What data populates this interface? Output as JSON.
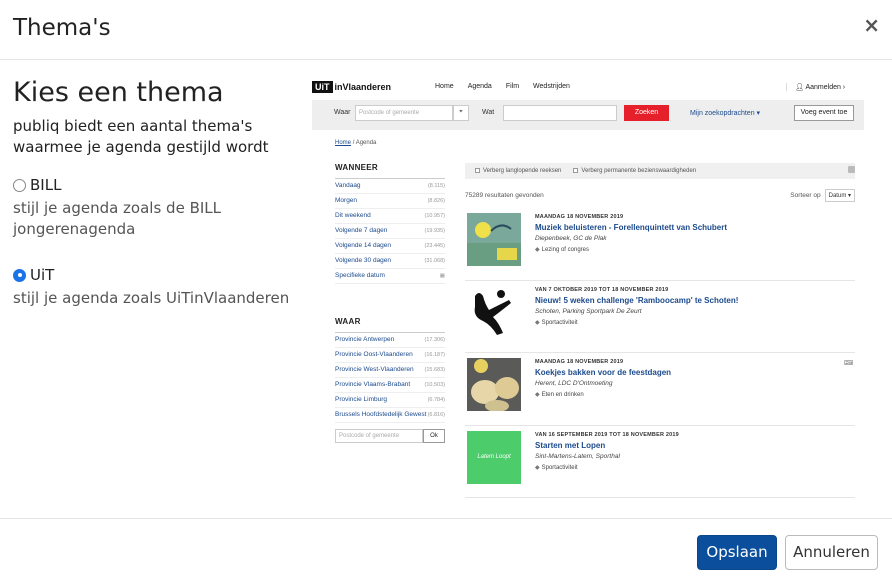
{
  "dialog": {
    "title": "Thema's",
    "close_label": "×"
  },
  "left": {
    "heading": "Kies een thema",
    "intro": "publiq biedt een aantal thema's waarmee je agenda gestijld wordt",
    "options": [
      {
        "label": "BILL",
        "description": "stijl je agenda zoals de BILL jongerenagenda",
        "selected": false
      },
      {
        "label": "UiT",
        "description": "stijl je agenda zoals UiTinVlaanderen",
        "selected": true
      }
    ]
  },
  "preview": {
    "logo_box": "UiT",
    "logo_text": "inVlaanderen",
    "nav": [
      "Home",
      "Agenda",
      "Film",
      "Wedstrijden"
    ],
    "login": "Aanmelden ›",
    "search": {
      "waar_label": "Waar",
      "waar_placeholder": "Postcode of gemeente",
      "wat_label": "Wat",
      "zoeken": "Zoeken",
      "mijn": "Mijn zoekopdrachten ▾",
      "voeg": "Voeg event toe"
    },
    "breadcrumb": {
      "home": "Home",
      "sep": "/",
      "current": "Agenda"
    },
    "wanneer": {
      "title": "WANNEER",
      "rows": [
        {
          "t": "Vandaag",
          "n": "(8.115)"
        },
        {
          "t": "Morgen",
          "n": "(8.826)"
        },
        {
          "t": "Dit weekend",
          "n": "(10.957)"
        },
        {
          "t": "Volgende 7 dagen",
          "n": "(19.935)"
        },
        {
          "t": "Volgende 14 dagen",
          "n": "(23.445)"
        },
        {
          "t": "Volgende 30 dagen",
          "n": "(31.068)"
        },
        {
          "t": "Specifieke datum",
          "n": "▦"
        }
      ]
    },
    "waar": {
      "title": "WAAR",
      "rows": [
        {
          "t": "Provincie Antwerpen",
          "n": "(17.306)"
        },
        {
          "t": "Provincie Oost-Vlaanderen",
          "n": "(16.187)"
        },
        {
          "t": "Provincie West-Vlaanderen",
          "n": "(15.683)"
        },
        {
          "t": "Provincie Vlaams-Brabant",
          "n": "(10.503)"
        },
        {
          "t": "Provincie Limburg",
          "n": "(6.784)"
        },
        {
          "t": "Brussels Hoofdstedelijk Gewest",
          "n": "(6.816)"
        }
      ],
      "pc_placeholder": "Postcode of gemeente",
      "ok": "Ok"
    },
    "filters": [
      "Verberg langlopende reeksen",
      "Verberg permanente bezienswaardigheden"
    ],
    "results_count": "75289 resultaten gevonden",
    "sort_label": "Sorteer op",
    "sort_value": "Datum ▾",
    "items": [
      {
        "date": "MAANDAG 18 NOVEMBER 2019",
        "title": "Muziek beluisteren - Forellenquintett van Schubert",
        "location": "Diepenbeek, GC de Plak",
        "tag": "Lezing of congres",
        "thumb_label": ""
      },
      {
        "date": "VAN 7 OKTOBER 2019 TOT 18 NOVEMBER 2019",
        "title": "Nieuw! 5 weken challenge 'Ramboocamp' te Schoten!",
        "location": "Schoten, Parking Sportpark De Zeurt",
        "tag": "Sportactiviteit",
        "thumb_label": ""
      },
      {
        "date": "MAANDAG 18 NOVEMBER 2019",
        "title": "Koekjes bakken voor de feestdagen",
        "location": "Herent, LDC D'Ontmoeting",
        "tag": "Eten en drinken",
        "thumb_label": ""
      },
      {
        "date": "VAN 16 SEPTEMBER 2019 TOT 18 NOVEMBER 2019",
        "title": "Starten met Lopen",
        "location": "Sint-Martens-Latem, Sporthal",
        "tag": "Sportactiviteit",
        "thumb_label": "Latem Loopt"
      }
    ]
  },
  "footer": {
    "save": "Opslaan",
    "cancel": "Annuleren"
  }
}
